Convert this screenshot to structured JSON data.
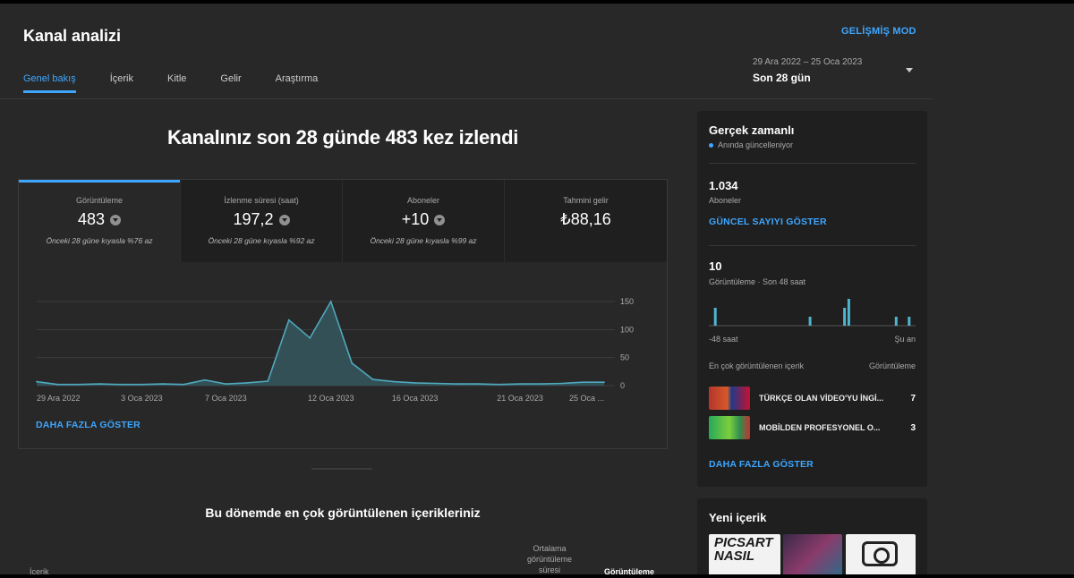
{
  "header": {
    "title": "Kanal analizi",
    "advanced_mode": "GELİŞMİŞ MOD",
    "tabs": [
      {
        "label": "Genel bakış"
      },
      {
        "label": "İçerik"
      },
      {
        "label": "Kitle"
      },
      {
        "label": "Gelir"
      },
      {
        "label": "Araştırma"
      }
    ],
    "active_tab": 0,
    "date_range": "29 Ara 2022 – 25 Oca 2023",
    "period": "Son 28 gün"
  },
  "main": {
    "headline": "Kanalınız son 28 günde 483 kez izlendi",
    "metrics": [
      {
        "label": "Görüntüleme",
        "value": "483",
        "compare": "Önceki 28 güne kıyasla %76 az"
      },
      {
        "label": "İzlenme süresi (saat)",
        "value": "197,2",
        "compare": "Önceki 28 güne kıyasla %92 az"
      },
      {
        "label": "Aboneler",
        "value": "+10",
        "compare": "Önceki 28 güne kıyasla %99 az"
      },
      {
        "label": "Tahmini gelir",
        "value": "₺88,16",
        "compare": ""
      }
    ],
    "more_link": "DAHA FAZLA GÖSTER",
    "top_content_title": "Bu dönemde en çok görüntülenen içerikleriniz",
    "table_headers": {
      "content": "İçerik",
      "avg_view_duration": [
        "Ortalama",
        "görüntüleme",
        "süresi"
      ],
      "views": "Görüntüleme"
    }
  },
  "chart_data": {
    "type": "area",
    "x": [
      "29 Ara 2022",
      "30 Ara",
      "31 Ara",
      "1 Oca",
      "2 Oca",
      "3 Oca 2023",
      "4 Oca",
      "5 Oca",
      "6 Oca",
      "7 Oca 2023",
      "8 Oca",
      "9 Oca",
      "10 Oca",
      "11 Oca",
      "12 Oca 2023",
      "13 Oca",
      "14 Oca",
      "15 Oca",
      "16 Oca 2023",
      "17 Oca",
      "18 Oca",
      "19 Oca",
      "20 Oca",
      "21 Oca 2023",
      "22 Oca",
      "23 Oca",
      "24 Oca",
      "25 Oca"
    ],
    "values": [
      7,
      2,
      2,
      3,
      2,
      2,
      3,
      2,
      10,
      3,
      5,
      8,
      117,
      85,
      150,
      40,
      11,
      7,
      5,
      4,
      3,
      3,
      2,
      3,
      3,
      4,
      6,
      6
    ],
    "tick_labels": [
      "29 Ara 2022",
      "3 Oca 2023",
      "7 Oca 2023",
      "12 Oca 2023",
      "16 Oca 2023",
      "21 Oca 2023",
      "25 Oca ..."
    ],
    "tick_indices": [
      0,
      5,
      9,
      14,
      18,
      23,
      27
    ],
    "yticks": [
      0,
      50,
      100,
      150
    ],
    "ylim": [
      0,
      150
    ],
    "grid": true,
    "colors": {
      "line": "#4fa9bd",
      "fill": "#34545c"
    }
  },
  "realtime": {
    "title": "Gerçek zamanlı",
    "subtitle": "Anında güncelleniyor",
    "subscribers_value": "1.034",
    "subscribers_label": "Aboneler",
    "subscribers_link": "GÜNCEL SAYIYI GÖSTER",
    "views_value": "10",
    "views_label": "Görüntüleme · Son 48 saat",
    "axis_start": "-48 saat",
    "axis_end": "Şu an",
    "hourly_views": [
      0,
      1,
      0,
      0,
      0,
      0,
      0,
      0,
      0,
      0,
      0,
      0,
      0,
      0,
      0,
      0,
      0,
      0,
      0,
      0,
      0,
      0,
      0,
      0.5,
      0,
      0,
      0,
      0,
      0,
      0,
      0,
      1,
      1.5,
      0,
      0,
      0,
      0,
      0,
      0,
      0,
      0,
      0,
      0,
      0.5,
      0,
      0,
      0.5,
      0
    ],
    "top_header_left": "En çok görüntülenen içerik",
    "top_header_right": "Görüntüleme",
    "top_items": [
      {
        "title": "TÜRKÇE OLAN VİDEO'YU İNGİ...",
        "views": "7"
      },
      {
        "title": "MOBİLDEN PROFESYONEL O...",
        "views": "3"
      }
    ],
    "more_link": "DAHA FAZLA GÖSTER"
  },
  "new_content": {
    "title": "Yeni içerik",
    "thumb_text": "PICSART NASIL"
  }
}
